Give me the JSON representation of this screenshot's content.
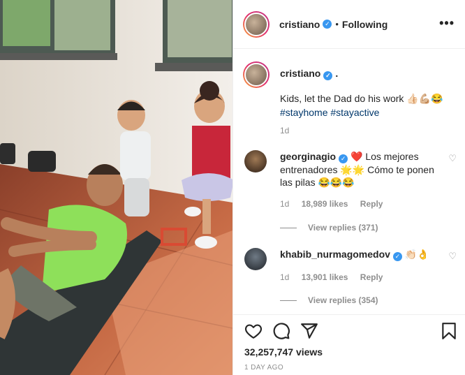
{
  "post": {
    "author": "cristiano",
    "follow_separator": "•",
    "follow_status": "Following",
    "more_glyph": "•••"
  },
  "caption": {
    "author": "cristiano",
    "trailing_dot": ".",
    "line1": "Kids, let the Dad do his work 👍🏻💪🏼😂",
    "hashtags": [
      "#stayhome",
      "#stayactive"
    ],
    "time": "1d"
  },
  "comments": [
    {
      "user": "georginagio",
      "text": "❤️ Los mejores entrenadores 🌟🌟 Cómo te ponen las pilas 😂😂😂",
      "time": "1d",
      "likes": "18,989 likes",
      "reply_label": "Reply",
      "view_replies": "View replies (371)"
    },
    {
      "user": "khabib_nurmagomedov",
      "text": "👏🏻👌",
      "time": "1d",
      "likes": "13,901 likes",
      "reply_label": "Reply",
      "view_replies": "View replies (354)"
    }
  ],
  "footer": {
    "views": "32,257,747 views",
    "time_ago": "1 DAY AGO"
  },
  "icons": [
    "heart-icon",
    "comment-icon",
    "share-icon",
    "bookmark-icon",
    "more-options-icon",
    "verified-badge-icon"
  ],
  "colors": {
    "verified": "#3897f0",
    "hashtag": "#00376b",
    "meta_gray": "#8e8e8e"
  }
}
